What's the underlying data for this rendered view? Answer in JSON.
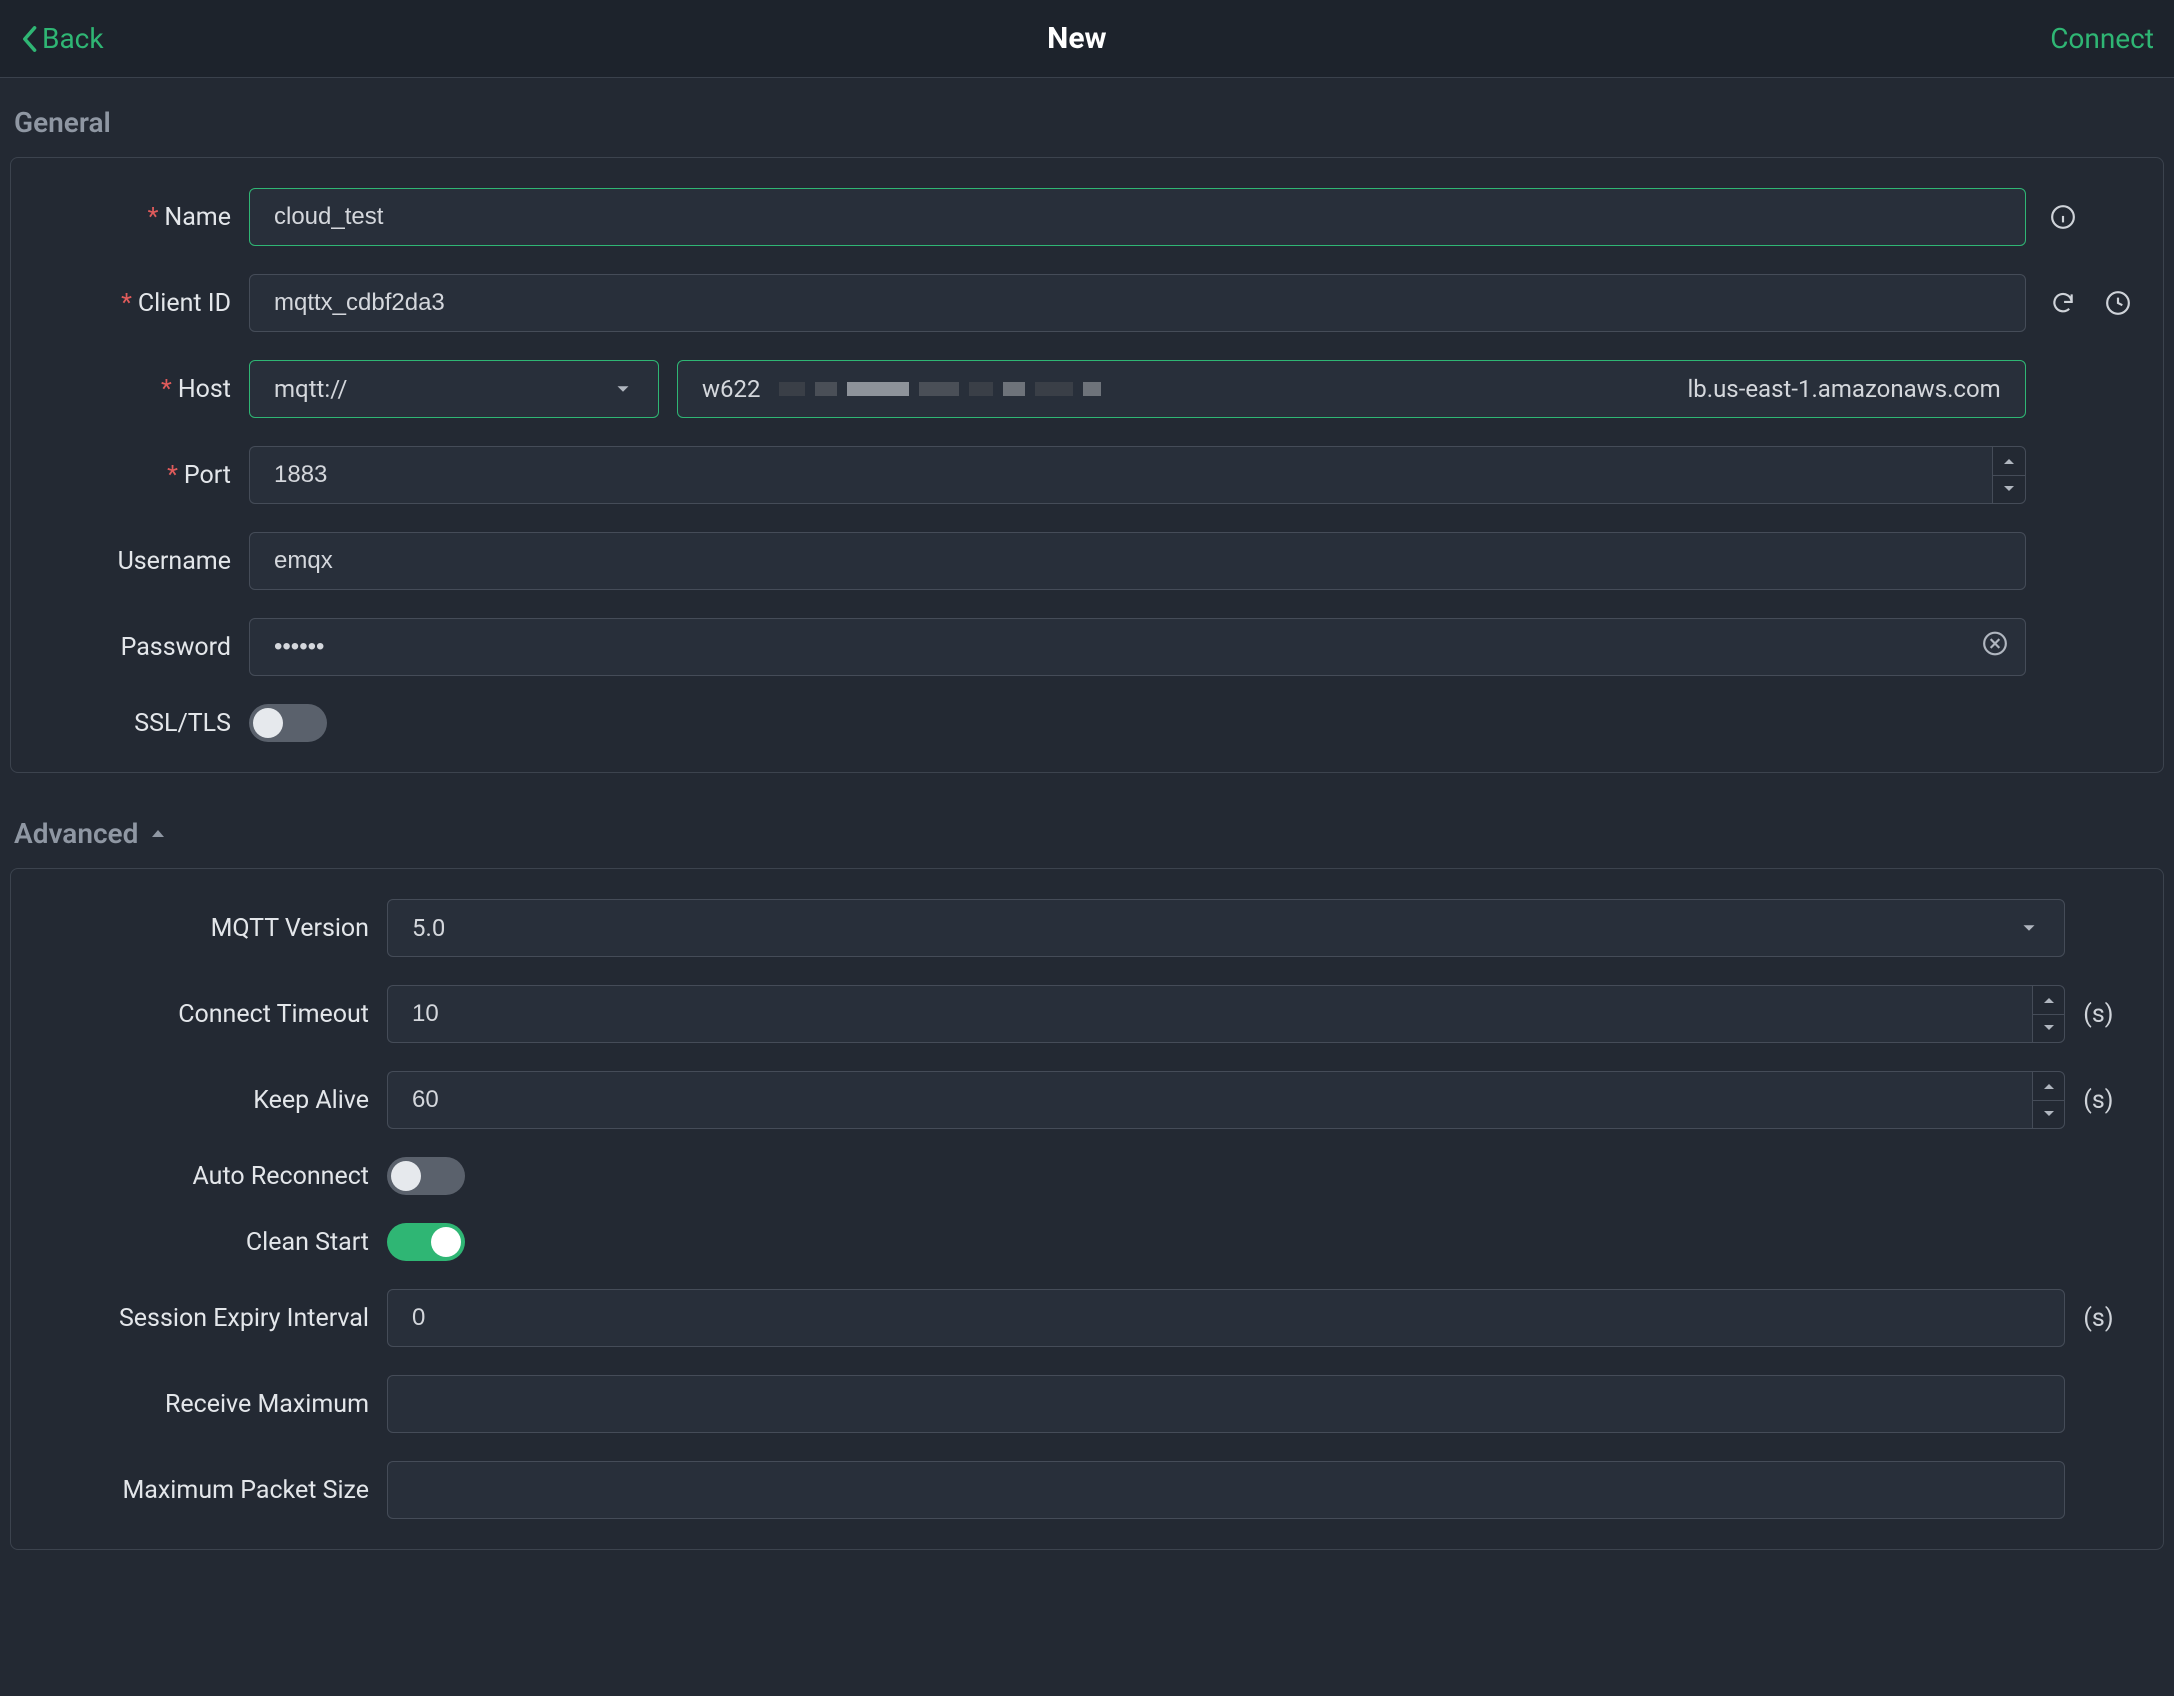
{
  "header": {
    "back_label": "Back",
    "title": "New",
    "connect_label": "Connect"
  },
  "sections": {
    "general_title": "General",
    "advanced_title": "Advanced"
  },
  "general": {
    "name": {
      "label": "Name",
      "value": "cloud_test"
    },
    "client_id": {
      "label": "Client ID",
      "value": "mqttx_cdbf2da3"
    },
    "host": {
      "label": "Host",
      "scheme": "mqtt://",
      "value_prefix": "w622",
      "value_suffix": "lb.us-east-1.amazonaws.com"
    },
    "port": {
      "label": "Port",
      "value": "1883"
    },
    "username": {
      "label": "Username",
      "value": "emqx"
    },
    "password": {
      "label": "Password",
      "masked": "••••••"
    },
    "ssl": {
      "label": "SSL/TLS",
      "on": false
    }
  },
  "advanced": {
    "mqtt_version": {
      "label": "MQTT Version",
      "value": "5.0"
    },
    "connect_timeout": {
      "label": "Connect Timeout",
      "value": "10",
      "unit": "(s)"
    },
    "keep_alive": {
      "label": "Keep Alive",
      "value": "60",
      "unit": "(s)"
    },
    "auto_reconnect": {
      "label": "Auto Reconnect",
      "on": false
    },
    "clean_start": {
      "label": "Clean Start",
      "on": true
    },
    "session_expiry": {
      "label": "Session Expiry Interval",
      "value": "0",
      "unit": "(s)"
    },
    "receive_max": {
      "label": "Receive Maximum",
      "value": ""
    },
    "max_packet_size": {
      "label": "Maximum Packet Size",
      "value": ""
    }
  }
}
